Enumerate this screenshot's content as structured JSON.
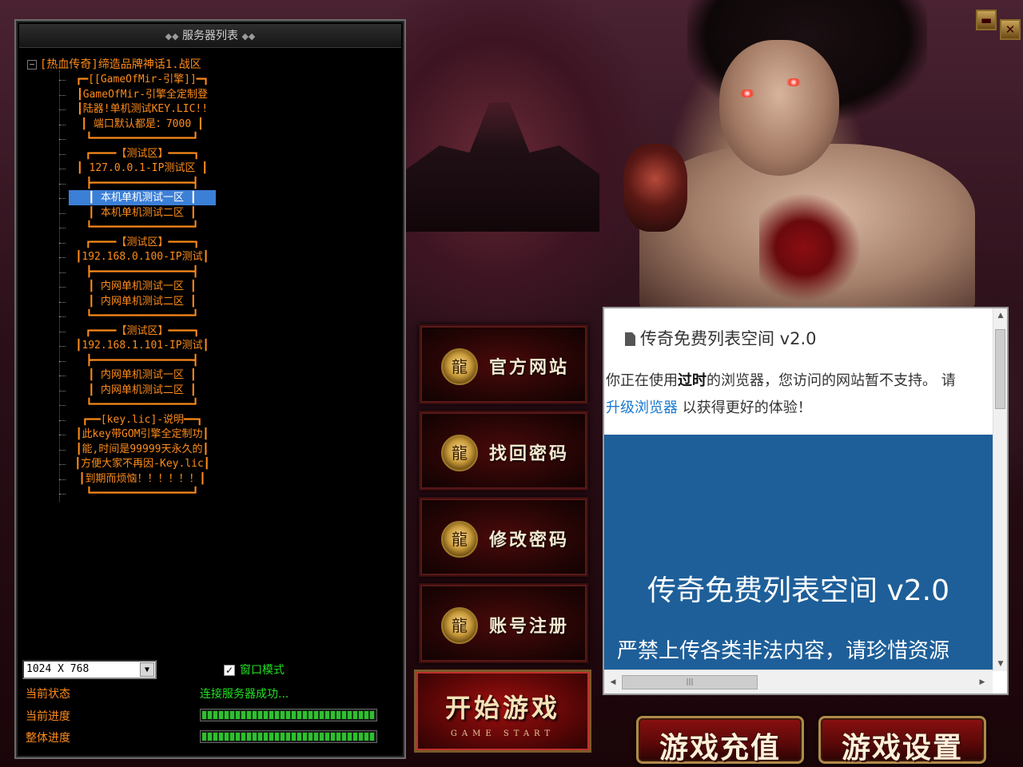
{
  "window": {
    "minimize_icon": "minimize-icon",
    "close_icon": "close-icon",
    "close_label": "✕"
  },
  "server_panel": {
    "title": "服务器列表",
    "root_label": "[热血传奇]缔造品牌神话1.战区",
    "items": [
      {
        "label": "┏━[[GameOfMir-引擎]]━┓",
        "selected": false
      },
      {
        "label": "┃GameOfMir-引擎全定制登",
        "selected": false
      },
      {
        "label": "┃陆器!单机测试KEY.LIC!!",
        "selected": false
      },
      {
        "label": "┃ 端口默认都是：7000  ┃",
        "selected": false
      },
      {
        "label": "┗━━━━━━━━━━━━━━━━┛",
        "selected": false
      },
      {
        "label": "┏━━━━【测试区】━━━━┓",
        "selected": false
      },
      {
        "label": "┃ 127.0.0.1-IP测试区 ┃",
        "selected": false
      },
      {
        "label": "┣━━━━━━━━━━━━━━━━┫",
        "selected": false
      },
      {
        "label": "┃  本机单机测试一区  ┃",
        "selected": true
      },
      {
        "label": "┃  本机单机测试二区  ┃",
        "selected": false
      },
      {
        "label": "┗━━━━━━━━━━━━━━━━┛",
        "selected": false
      },
      {
        "label": "┏━━━━【测试区】━━━━┓",
        "selected": false
      },
      {
        "label": "┃192.168.0.100-IP测试┃",
        "selected": false
      },
      {
        "label": "┣━━━━━━━━━━━━━━━━┫",
        "selected": false
      },
      {
        "label": "┃  内网单机测试一区  ┃",
        "selected": false
      },
      {
        "label": "┃  内网单机测试二区  ┃",
        "selected": false
      },
      {
        "label": "┗━━━━━━━━━━━━━━━━┛",
        "selected": false
      },
      {
        "label": "┏━━━━【测试区】━━━━┓",
        "selected": false
      },
      {
        "label": "┃192.168.1.101-IP测试┃",
        "selected": false
      },
      {
        "label": "┣━━━━━━━━━━━━━━━━┫",
        "selected": false
      },
      {
        "label": "┃  内网单机测试一区  ┃",
        "selected": false
      },
      {
        "label": "┃  内网单机测试二区  ┃",
        "selected": false
      },
      {
        "label": "┗━━━━━━━━━━━━━━━━┛",
        "selected": false
      },
      {
        "label": "┏━━[key.lic]-说明━━┓",
        "selected": false
      },
      {
        "label": "┃此key带GOM引擎全定制功┃",
        "selected": false
      },
      {
        "label": "┃能,时间是99999天永久的┃",
        "selected": false
      },
      {
        "label": "┃方便大家不再因-Key.lic┃",
        "selected": false
      },
      {
        "label": "┃到期而烦恼！！！！！！┃",
        "selected": false
      },
      {
        "label": "┗━━━━━━━━━━━━━━━━┛",
        "selected": false
      }
    ],
    "resolution": "1024 X 768",
    "window_mode_label": "窗口模式",
    "window_mode_checked": true,
    "status_label": "当前状态",
    "status_value": "连接服务器成功...",
    "current_progress_label": "当前进度",
    "current_progress": 1.0,
    "overall_progress_label": "整体进度",
    "overall_progress": 1.0
  },
  "menu": {
    "official_site": "官方网站",
    "recover_password": "找回密码",
    "change_password": "修改密码",
    "register": "账号注册",
    "start_game": "开始游戏",
    "start_game_sub": "GAME START",
    "recharge": "游戏充值",
    "settings": "游戏设置"
  },
  "browser": {
    "title": "传奇免费列表空间 v2.0",
    "line1_prefix": "你正在使用",
    "line1_bold": "过时",
    "line1_suffix": "的浏览器，您访问的网站暂不支持。 请",
    "line2_link": "升级浏览器",
    "line2_suffix": " 以获得更好的体验！",
    "banner_title": "传奇免费列表空间 v2.0",
    "banner_sub": "严禁上传各类非法内容，请珍惜资源",
    "colors": {
      "banner": "#1e5f99",
      "link": "#1a7ad0"
    }
  }
}
